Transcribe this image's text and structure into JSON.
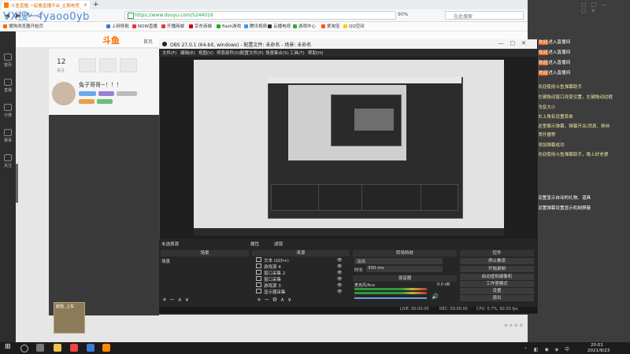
{
  "watermark": "VX搜一fyaoo0yb",
  "browser": {
    "tabs": [
      {
        "title": "斗鱼直播,一起看直播平台_企鹅电竞_分享..."
      }
    ],
    "url": "https://www.douyu.com/5244016",
    "zoom": "90%",
    "search_placeholder": "在此搜索",
    "bookmarks": [
      "搜狗浏览器开始页",
      "上网导航",
      "NOW直播",
      "开播商城",
      "京东商城",
      "flash游戏",
      "腾讯视频",
      "云播电视",
      "游戏中心",
      "爱淘宝",
      "QQ空间"
    ]
  },
  "douyu": {
    "logo": "斗鱼",
    "page_label": "首页",
    "follow_count": "12",
    "follow_label": "关注",
    "anchor_name": "兔子哥哥~！！！",
    "left_nav": [
      "首页",
      "直播",
      "分类",
      "赛事",
      "关注"
    ],
    "gift_label": "超值, 上车"
  },
  "obs": {
    "title": "OBS 27.0.1 (64-bit, windows) - 配置文件: 未命名 - 场景: 未命名",
    "menu": [
      "文件(F)",
      "编辑(E)",
      "视图(V)",
      "停靠部件(D)",
      "配置文件(P)",
      "场景集合(S)",
      "工具(T)",
      "帮助(H)"
    ],
    "no_source": "未选择源",
    "properties": "属性",
    "filters": "滤镜",
    "panels": {
      "scenes": "场景",
      "sources": "来源",
      "transitions": "转场特效",
      "mixer": "混音器",
      "controls": "控件"
    },
    "scene_item": "场景",
    "sources": [
      "文本 (GDI+)",
      "游戏源 4",
      "窗口采集 2",
      "窗口采集",
      "游戏源 3",
      "显示器采集"
    ],
    "transition": {
      "type": "淡出",
      "duration_label": "时长",
      "duration": "300 ms"
    },
    "mixer": {
      "track": "麦克风/Aux",
      "db": "0.0 dB"
    },
    "controls": [
      "停止推流",
      "开始录制",
      "启动虚拟摄像机",
      "工作室模式",
      "设置",
      "退出"
    ],
    "status": {
      "live": "LIVE: 00:00:00",
      "rec": "REC: 00:00:00",
      "cpu": "CPU: 0.7%, 60.00 fps"
    }
  },
  "chat": {
    "messages": [
      {
        "nick": "欢迎",
        "text": "进入直播间"
      },
      {
        "nick": "欢迎",
        "text": "进入直播间"
      },
      {
        "nick": "欢迎",
        "text": "进入直播间"
      },
      {
        "nick": "欢迎",
        "text": "进入直播间"
      }
    ],
    "system": [
      "欢迎使用斗鱼弹幕助手",
      "左键拖动窗口改变位置，左键拖动边框",
      "改变大小",
      "右上角有设置菜单",
      "这里展示弹幕，弹幕开关/消息、粉丝",
      "牌开播等",
      "添加弹幕成功",
      "欢迎使用斗鱼弹幕助手，晚上好老婆"
    ],
    "notice": [
      "设置显示自动的礼物、道具",
      "设置弹幕设置显示机制屏蔽"
    ]
  },
  "taskbar": {
    "time": "20:01",
    "date": "2021/9/23"
  }
}
